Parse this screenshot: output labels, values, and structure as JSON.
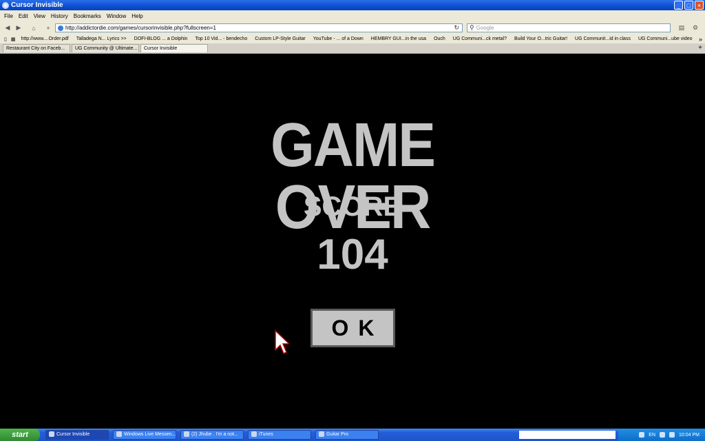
{
  "window": {
    "title": "Cursor Invisible",
    "buttons": [
      "_",
      "□",
      "×"
    ]
  },
  "menu": [
    "File",
    "Edit",
    "View",
    "History",
    "Bookmarks",
    "Window",
    "Help"
  ],
  "nav": {
    "url": "http://addictordie.com/games/cursorinvisible.php?fullscreen=1",
    "search_placeholder": "Google"
  },
  "bookmarks": [
    "http://www....Order.pdf",
    "Talladega N... Lyrics >>",
    "DOFI-BLOG ... a Dolphin",
    "Top 10 Vid... - bendecho",
    "Custom LP-Style Guitar",
    "YouTube - ... of a Down",
    "HEMBRY GUI...in the usa",
    "Ouch",
    "UG Communi...ck metal?",
    "Build Your O...tric Guitar!",
    "UG Communit...id in class",
    "UG Communi...ube video"
  ],
  "tabs": [
    {
      "label": "Restaurant City on Faceb..."
    },
    {
      "label": "UG Community @ Ultimate..."
    },
    {
      "label": "Cursor Invisible"
    }
  ],
  "game": {
    "heading": "GAME OVER",
    "score_label": "SCORE",
    "score_value": "104",
    "ok_label": "OK"
  },
  "taskbar": {
    "start_label": "start",
    "tasks": [
      {
        "label": "Cursor Invisible"
      },
      {
        "label": "Windows Live Messen..."
      },
      {
        "label": "(2) Jhube . I'm a not..."
      },
      {
        "label": "iTunes"
      },
      {
        "label": "Guitar Pro"
      }
    ],
    "language": "EN",
    "clock": "10:04 PM"
  },
  "colors": {
    "game_text": "#c4c4c4",
    "game_bg": "#000000",
    "titlebar": "#0a4ecf",
    "taskbar": "#245edb"
  }
}
